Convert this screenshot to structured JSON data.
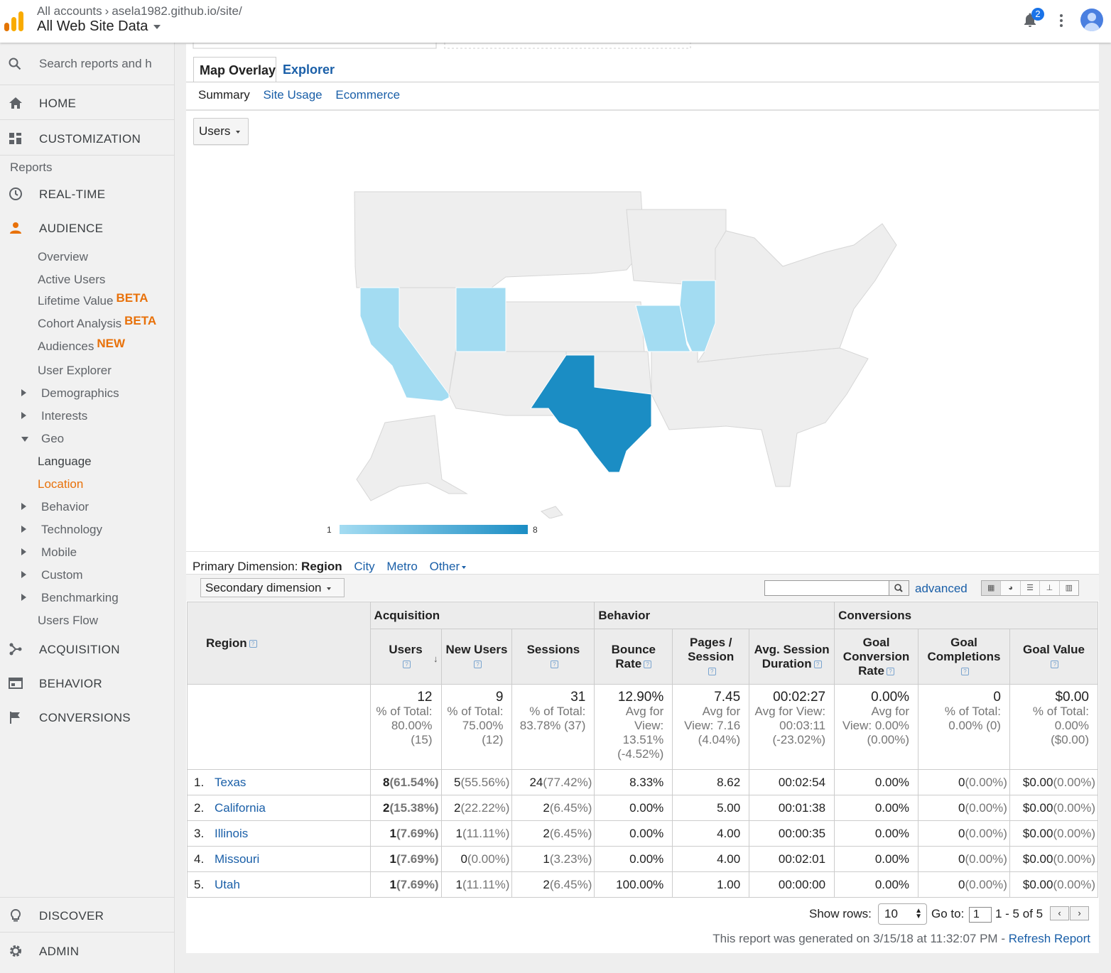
{
  "header": {
    "breadcrumb": [
      "All accounts",
      "asela1982.github.io/site/"
    ],
    "view_name": "All Web Site Data",
    "notification_count": "2"
  },
  "sidebar": {
    "search_placeholder": "Search reports and h",
    "home": "HOME",
    "customization": "CUSTOMIZATION",
    "reports_label": "Reports",
    "realtime": "REAL-TIME",
    "audience": "AUDIENCE",
    "audience_items": {
      "overview": "Overview",
      "active_users": "Active Users",
      "lifetime_value": "Lifetime Value",
      "lifetime_value_badge": "BETA",
      "cohort": "Cohort Analysis",
      "cohort_badge": "BETA",
      "audiences": "Audiences",
      "audiences_badge": "NEW",
      "user_explorer": "User Explorer",
      "demographics": "Demographics",
      "interests": "Interests",
      "geo": "Geo",
      "language": "Language",
      "location": "Location",
      "behavior": "Behavior",
      "technology": "Technology",
      "mobile": "Mobile",
      "custom": "Custom",
      "benchmarking": "Benchmarking",
      "users_flow": "Users Flow"
    },
    "acquisition": "ACQUISITION",
    "behavior": "BEHAVIOR",
    "conversions": "CONVERSIONS",
    "discover": "DISCOVER",
    "admin": "ADMIN"
  },
  "tabs": {
    "map_overlay": "Map Overlay",
    "explorer": "Explorer"
  },
  "subtabs": {
    "summary": "Summary",
    "site_usage": "Site Usage",
    "ecommerce": "Ecommerce"
  },
  "metric_select": "Users",
  "map_legend": {
    "min": "1",
    "max": "8"
  },
  "map_colors": {
    "none": "#eeeeee",
    "low": "#a3dcf2",
    "mid": "#8fd0ec",
    "high": "#1b8dc4"
  },
  "dimension": {
    "label": "Primary Dimension:",
    "current": "Region",
    "city": "City",
    "metro": "Metro",
    "other": "Other",
    "secondary": "Secondary dimension",
    "advanced": "advanced"
  },
  "table": {
    "groups": {
      "acquisition": "Acquisition",
      "behavior": "Behavior",
      "conversions": "Conversions"
    },
    "headers": {
      "region": "Region",
      "users": "Users",
      "new_users": "New Users",
      "sessions": "Sessions",
      "bounce_rate": "Bounce Rate",
      "pages_session": "Pages / Session",
      "avg_session": "Avg. Session Duration",
      "goal_conv_rate": "Goal Conversion Rate",
      "goal_completions": "Goal Completions",
      "goal_value": "Goal Value"
    },
    "totals": {
      "users": {
        "value": "12",
        "note": "% of Total: 80.00% (15)"
      },
      "new_users": {
        "value": "9",
        "note": "% of Total: 75.00% (12)"
      },
      "sessions": {
        "value": "31",
        "note": "% of Total: 83.78% (37)"
      },
      "bounce_rate": {
        "value": "12.90%",
        "note": "Avg for View: 13.51% (-4.52%)"
      },
      "pages_session": {
        "value": "7.45",
        "note": "Avg for View: 7.16 (4.04%)"
      },
      "avg_session": {
        "value": "00:02:27",
        "note": "Avg for View: 00:03:11 (-23.02%)"
      },
      "goal_conv_rate": {
        "value": "0.00%",
        "note": "Avg for View: 0.00% (0.00%)"
      },
      "goal_completions": {
        "value": "0",
        "note": "% of Total: 0.00% (0)"
      },
      "goal_value": {
        "value": "$0.00",
        "note": "% of Total: 0.00% ($0.00)"
      }
    },
    "rows": [
      {
        "idx": "1.",
        "region": "Texas",
        "users": "8",
        "users_pct": "(61.54%)",
        "new_users": "5",
        "new_users_pct": "(55.56%)",
        "sessions": "24",
        "sessions_pct": "(77.42%)",
        "bounce_rate": "8.33%",
        "pages_session": "8.62",
        "avg_session": "00:02:54",
        "goal_conv_rate": "0.00%",
        "goal_completions": "0",
        "goal_completions_pct": "(0.00%)",
        "goal_value": "$0.00",
        "goal_value_pct": "(0.00%)"
      },
      {
        "idx": "2.",
        "region": "California",
        "users": "2",
        "users_pct": "(15.38%)",
        "new_users": "2",
        "new_users_pct": "(22.22%)",
        "sessions": "2",
        "sessions_pct": "(6.45%)",
        "bounce_rate": "0.00%",
        "pages_session": "5.00",
        "avg_session": "00:01:38",
        "goal_conv_rate": "0.00%",
        "goal_completions": "0",
        "goal_completions_pct": "(0.00%)",
        "goal_value": "$0.00",
        "goal_value_pct": "(0.00%)"
      },
      {
        "idx": "3.",
        "region": "Illinois",
        "users": "1",
        "users_pct": "(7.69%)",
        "new_users": "1",
        "new_users_pct": "(11.11%)",
        "sessions": "2",
        "sessions_pct": "(6.45%)",
        "bounce_rate": "0.00%",
        "pages_session": "4.00",
        "avg_session": "00:00:35",
        "goal_conv_rate": "0.00%",
        "goal_completions": "0",
        "goal_completions_pct": "(0.00%)",
        "goal_value": "$0.00",
        "goal_value_pct": "(0.00%)"
      },
      {
        "idx": "4.",
        "region": "Missouri",
        "users": "1",
        "users_pct": "(7.69%)",
        "new_users": "0",
        "new_users_pct": "(0.00%)",
        "sessions": "1",
        "sessions_pct": "(3.23%)",
        "bounce_rate": "0.00%",
        "pages_session": "4.00",
        "avg_session": "00:02:01",
        "goal_conv_rate": "0.00%",
        "goal_completions": "0",
        "goal_completions_pct": "(0.00%)",
        "goal_value": "$0.00",
        "goal_value_pct": "(0.00%)"
      },
      {
        "idx": "5.",
        "region": "Utah",
        "users": "1",
        "users_pct": "(7.69%)",
        "new_users": "1",
        "new_users_pct": "(11.11%)",
        "sessions": "2",
        "sessions_pct": "(6.45%)",
        "bounce_rate": "100.00%",
        "pages_session": "1.00",
        "avg_session": "00:00:00",
        "goal_conv_rate": "0.00%",
        "goal_completions": "0",
        "goal_completions_pct": "(0.00%)",
        "goal_value": "$0.00",
        "goal_value_pct": "(0.00%)"
      }
    ]
  },
  "pagination": {
    "show_rows_label": "Show rows:",
    "show_rows_value": "10",
    "goto_label": "Go to:",
    "goto_value": "1",
    "range": "1 - 5 of 5"
  },
  "footer": {
    "generated": "This report was generated on 3/15/18 at 11:32:07 PM -",
    "refresh": "Refresh Report"
  }
}
